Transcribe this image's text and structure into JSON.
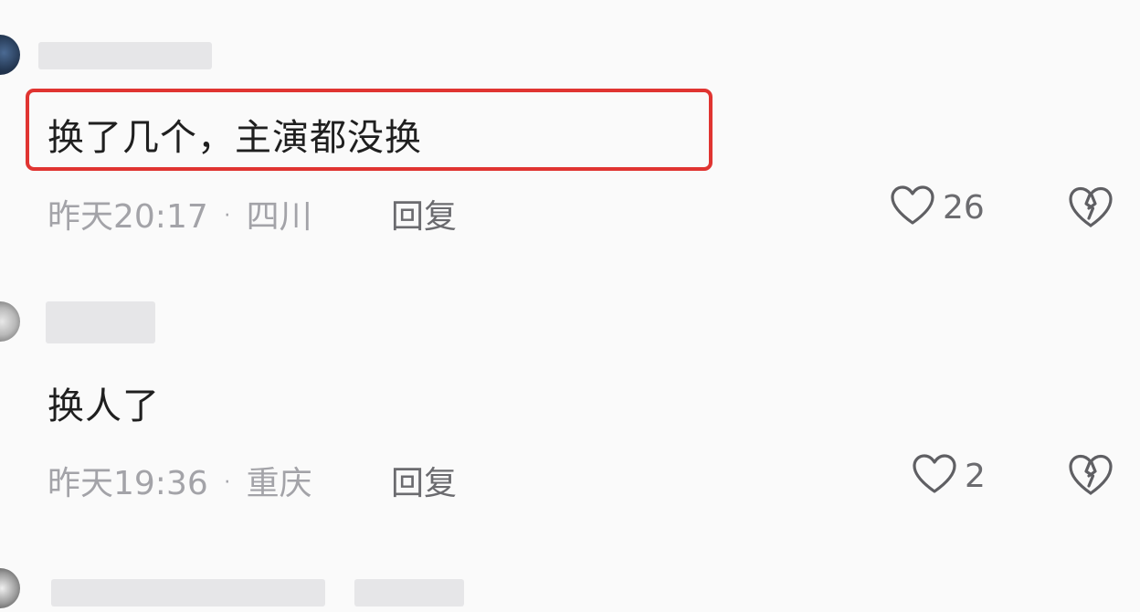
{
  "comments": [
    {
      "text": "换了几个，主演都没换",
      "time": "昨天20:17",
      "location": "四川",
      "reply_label": "回复",
      "likes": "26"
    },
    {
      "text": "换人了",
      "time": "昨天19:36",
      "location": "重庆",
      "reply_label": "回复",
      "likes": "2"
    }
  ],
  "separator": "·",
  "icons": {
    "like": "heart-outline-icon",
    "dislike": "broken-heart-icon"
  },
  "colors": {
    "highlight_border": "#e03431",
    "meta_text": "#a3a3a8",
    "body_text": "#1f1f1f"
  }
}
